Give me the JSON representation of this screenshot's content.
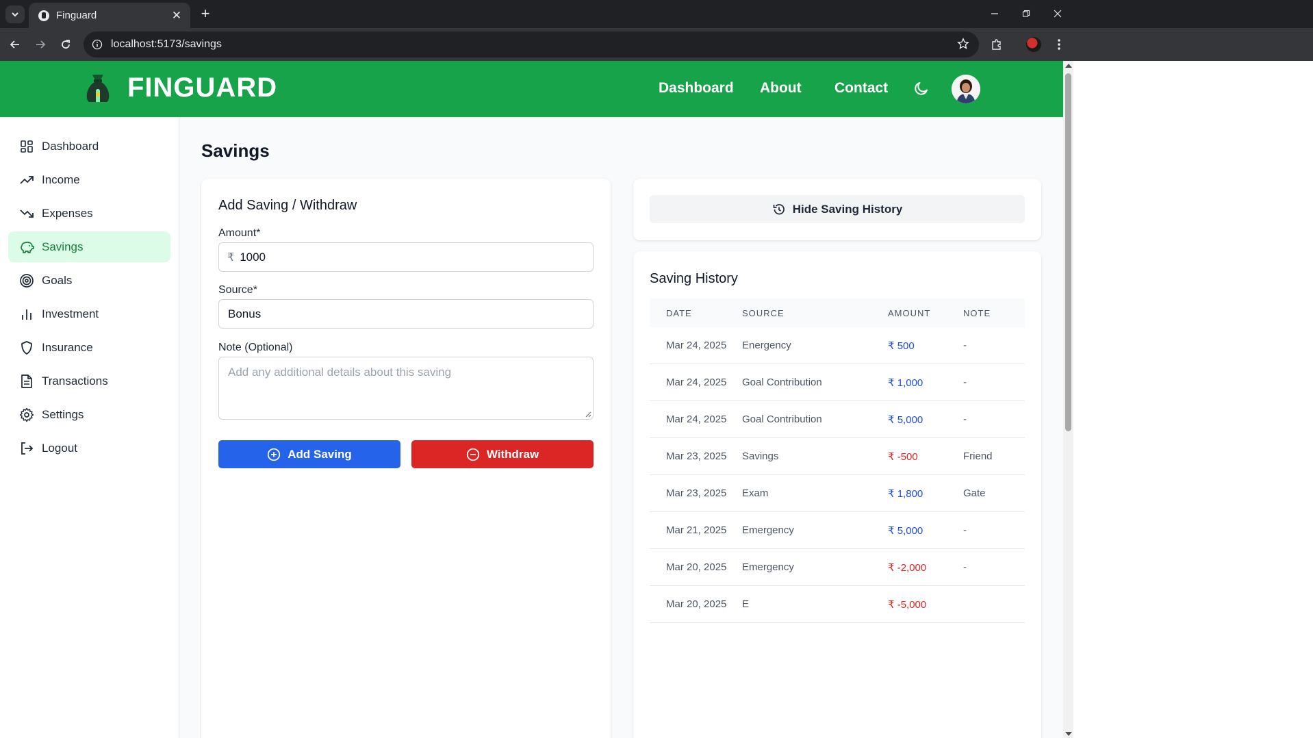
{
  "browser": {
    "tab_title": "Finguard",
    "url": "localhost:5173/savings"
  },
  "header": {
    "brand": "FINGUARD",
    "nav": [
      "Dashboard",
      "About",
      "Contact"
    ]
  },
  "sidebar": {
    "items": [
      {
        "label": "Dashboard",
        "icon": "dashboard-grid-icon"
      },
      {
        "label": "Income",
        "icon": "trending-up-icon"
      },
      {
        "label": "Expenses",
        "icon": "trending-down-icon"
      },
      {
        "label": "Savings",
        "icon": "piggy-bank-icon",
        "active": true
      },
      {
        "label": "Goals",
        "icon": "target-icon"
      },
      {
        "label": "Investment",
        "icon": "bar-chart-icon"
      },
      {
        "label": "Insurance",
        "icon": "shield-icon"
      },
      {
        "label": "Transactions",
        "icon": "document-icon"
      },
      {
        "label": "Settings",
        "icon": "gear-icon"
      },
      {
        "label": "Logout",
        "icon": "logout-icon"
      }
    ]
  },
  "page": {
    "title": "Savings"
  },
  "form": {
    "title": "Add Saving / Withdraw",
    "amount_label": "Amount*",
    "amount_prefix": "₹",
    "amount_value": "1000",
    "source_label": "Source*",
    "source_value": "Bonus",
    "note_label": "Note (Optional)",
    "note_placeholder": "Add any additional details about this saving",
    "add_button": "Add Saving",
    "withdraw_button": "Withdraw"
  },
  "history_toggle": {
    "label": "Hide Saving History"
  },
  "history": {
    "title": "Saving History",
    "columns": [
      "DATE",
      "SOURCE",
      "AMOUNT",
      "NOTE"
    ],
    "rows": [
      {
        "date": "Mar 24, 2025",
        "source": "Energency",
        "amount": "₹ 500",
        "note": "-",
        "negative": false
      },
      {
        "date": "Mar 24, 2025",
        "source": "Goal Contribution",
        "amount": "₹ 1,000",
        "note": "-",
        "negative": false
      },
      {
        "date": "Mar 24, 2025",
        "source": "Goal Contribution",
        "amount": "₹ 5,000",
        "note": "-",
        "negative": false
      },
      {
        "date": "Mar 23, 2025",
        "source": "Savings",
        "amount": "₹ -500",
        "note": "Friend",
        "negative": true
      },
      {
        "date": "Mar 23, 2025",
        "source": "Exam",
        "amount": "₹ 1,800",
        "note": "Gate",
        "negative": false
      },
      {
        "date": "Mar 21, 2025",
        "source": "Emergency",
        "amount": "₹ 5,000",
        "note": "-",
        "negative": false
      },
      {
        "date": "Mar 20, 2025",
        "source": "Emergency",
        "amount": "₹ -2,000",
        "note": "-",
        "negative": true
      },
      {
        "date": "Mar 20, 2025",
        "source": "E",
        "amount": "₹ -5,000",
        "note": "",
        "negative": true
      }
    ]
  },
  "colors": {
    "brand_green": "#16a34a",
    "active_bg": "#dcfce7",
    "primary_blue": "#2563eb",
    "danger_red": "#dc2626"
  }
}
